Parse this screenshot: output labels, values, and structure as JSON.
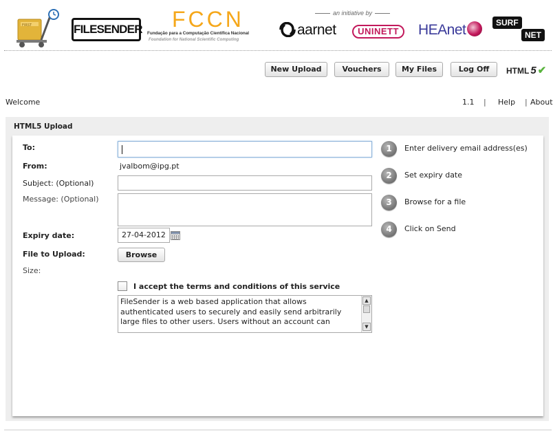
{
  "banner": {
    "logos": {
      "filesender": "FILESENDER",
      "fccn": "FCCN",
      "fccn_sub1": "Fundação para a Computação Científica Nacional",
      "fccn_sub2": "Foundation for National Scientific Computing",
      "initiative": "an initiative by",
      "aarnet": "aarnet",
      "uninett": "UNINETT",
      "heanet": "HEAnet",
      "surfnet_top": "SURF",
      "surfnet_bottom": "NET"
    }
  },
  "menu": {
    "new_upload": "New Upload",
    "vouchers": "Vouchers",
    "my_files": "My Files",
    "log_off": "Log Off",
    "html5_label": "HTML",
    "html5_five": "5",
    "html5_check": "✔"
  },
  "topbar": {
    "welcome": "Welcome",
    "version": "1.1",
    "sep": "|",
    "help": "Help",
    "about": "About"
  },
  "panel": {
    "title": "HTML5 Upload"
  },
  "form": {
    "to_label": "To:",
    "to_value": "",
    "from_label": "From:",
    "from_value": "jvalbom@ipg.pt",
    "subject_label": "Subject: (Optional)",
    "subject_value": "",
    "message_label": "Message: (Optional)",
    "message_value": "",
    "expiry_label": "Expiry date:",
    "expiry_value": "27-04-2012",
    "file_label": "File to Upload:",
    "browse_label": "Browse",
    "size_label": "Size:",
    "terms_checked": false,
    "terms_label": "I accept the terms and conditions of this service",
    "terms_text": "FileSender is a web based application that allows authenticated users to securely and easily send arbitrarily large files to other users. Users without an account can"
  },
  "steps": [
    {
      "num": "1",
      "text": "Enter delivery email address(es)"
    },
    {
      "num": "2",
      "text": "Set expiry date"
    },
    {
      "num": "3",
      "text": "Browse for a file"
    },
    {
      "num": "4",
      "text": "Click on Send"
    }
  ],
  "colors": {
    "fccn_orange": "#f5a71a",
    "uninett_magenta": "#c2185b",
    "heanet_blue": "#3a3a9a",
    "check_green": "#58b33c",
    "step_grey": "#7c7c7c",
    "panel_bg": "#eeeeee"
  }
}
